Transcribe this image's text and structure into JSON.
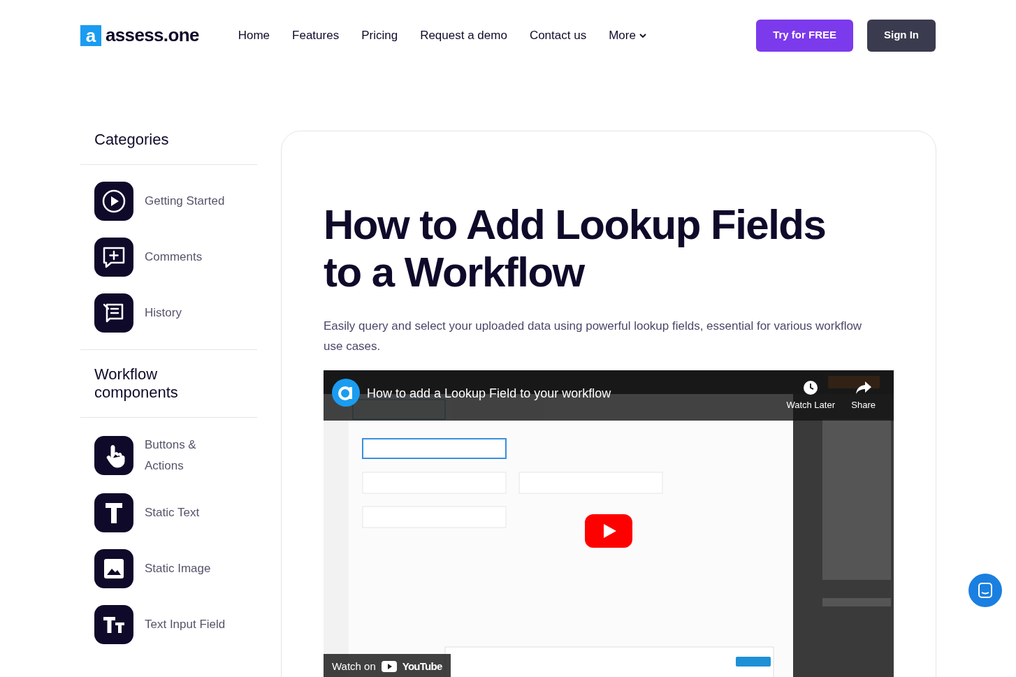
{
  "header": {
    "logo_mark": "a",
    "logo_text": "assess.one",
    "nav": [
      {
        "label": "Home",
        "dropdown": false
      },
      {
        "label": "Features",
        "dropdown": false
      },
      {
        "label": "Pricing",
        "dropdown": false
      },
      {
        "label": "Request a demo",
        "dropdown": false
      },
      {
        "label": "Contact us",
        "dropdown": false
      },
      {
        "label": "More",
        "dropdown": true
      }
    ],
    "try_button": "Try for FREE",
    "signin_button": "Sign In"
  },
  "sidebar": {
    "sections": [
      {
        "title": "Categories",
        "items": [
          {
            "label": "Getting Started"
          },
          {
            "label": "Comments"
          },
          {
            "label": "History"
          }
        ]
      },
      {
        "title": "Workflow components",
        "items": [
          {
            "label": "Buttons & Actions"
          },
          {
            "label": "Static Text"
          },
          {
            "label": "Static Image"
          },
          {
            "label": "Text Input Field"
          }
        ]
      }
    ]
  },
  "article": {
    "title": "How to Add Lookup Fields to a Workflow",
    "subtitle": "Easily query and select your uploaded data using powerful lookup fields, essential for various workflow use cases.",
    "video": {
      "kind": "picture",
      "title": "How to add a Lookup Field to your workflow",
      "watch_later": "Watch Later",
      "share": "Share",
      "watch_on": "Watch on",
      "youtube": "YouTube"
    }
  }
}
